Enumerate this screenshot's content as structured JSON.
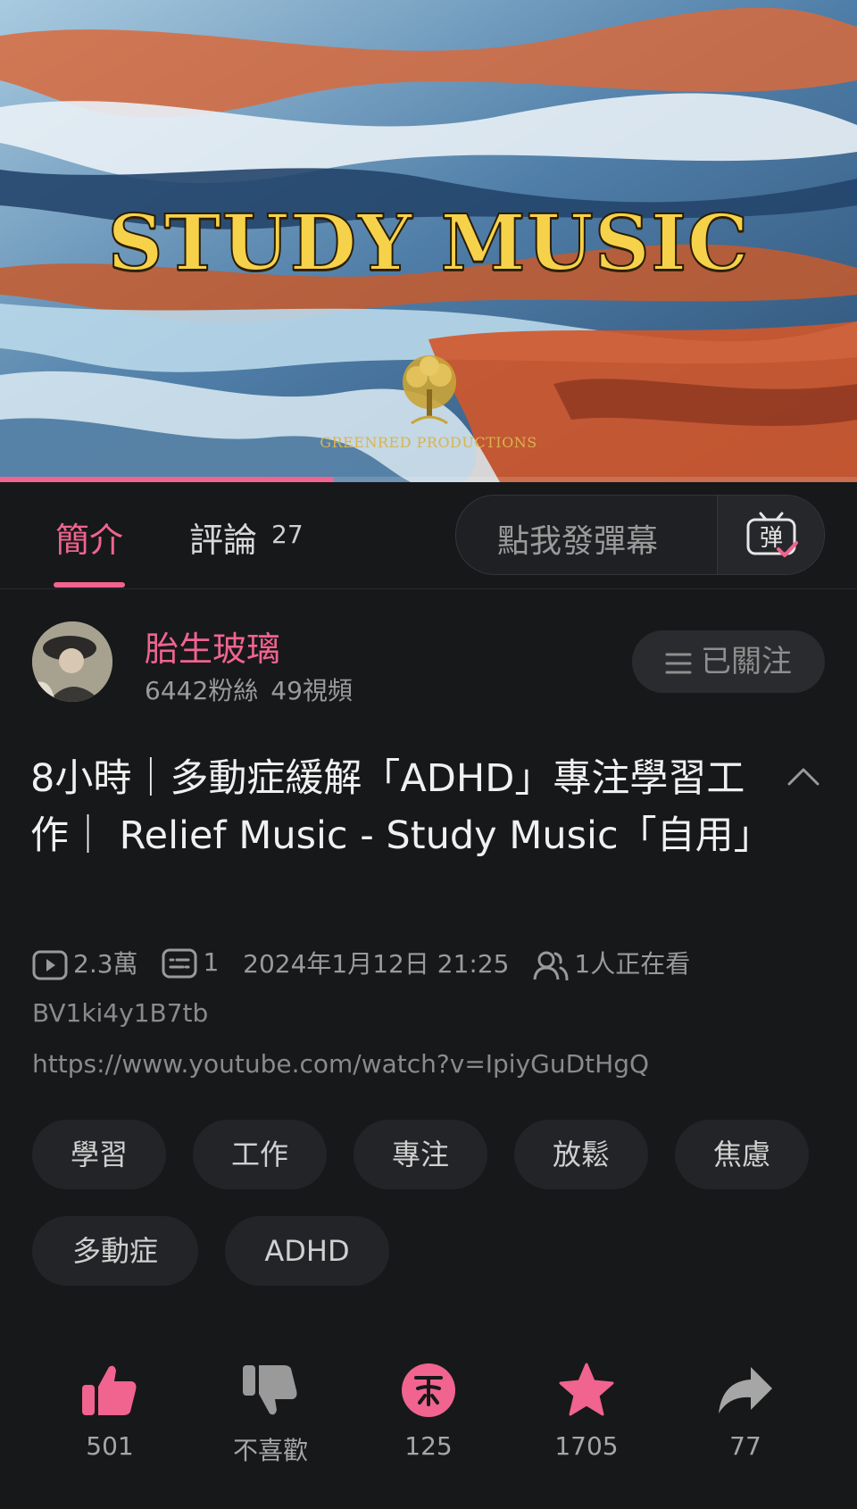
{
  "video": {
    "title_text": "STUDY MUSIC",
    "production_text": "GREENRED PRODUCTIONS",
    "progress_fraction": 0.39
  },
  "tabs": {
    "intro_label": "簡介",
    "comments_label": "評論",
    "comments_count": "27",
    "danmaku_placeholder": "點我發彈幕",
    "danmaku_icon": "danmaku-icon",
    "accent_color": "#f0648f"
  },
  "author": {
    "name": "胎生玻璃",
    "followers": "6442粉絲",
    "videos": "49視頻",
    "follow_label": "已關注",
    "follow_icon": "menu-icon"
  },
  "video_info": {
    "title": "8小時｜多動症緩解「ADHD」專注學習工作｜ Relief Music - Study Music「自用」",
    "views": "2.3萬",
    "danmaku_count": "1",
    "published": "2024年1月12日 21:25",
    "watching": "1人正在看",
    "bvid": "BV1ki4y1B7tb",
    "source_url": "https://www.youtube.com/watch?v=IpiyGuDtHgQ"
  },
  "tags": [
    "學習",
    "工作",
    "專注",
    "放鬆",
    "焦慮",
    "多動症",
    "ADHD"
  ],
  "actions": {
    "like": "501",
    "dislike": "不喜歡",
    "coin": "125",
    "favorite": "1705",
    "share": "77"
  }
}
